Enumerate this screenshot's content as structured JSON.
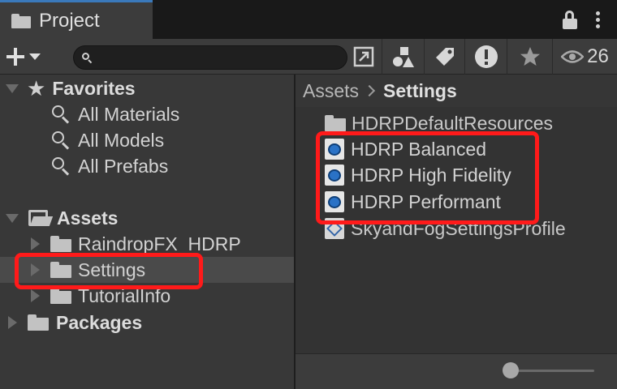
{
  "tab": {
    "title": "Project",
    "icon": "folder-icon"
  },
  "header_icons": [
    "lock-icon",
    "kebab-menu-icon"
  ],
  "toolbar": {
    "search_value": "",
    "buttons": [
      "create-dropdown",
      "search-by-type",
      "search-by-label",
      "search-by-importlog",
      "favorites-star"
    ],
    "visibility_count": "26"
  },
  "favorites": {
    "label": "Favorites",
    "items": [
      {
        "label": "All Materials"
      },
      {
        "label": "All Models"
      },
      {
        "label": "All Prefabs"
      }
    ]
  },
  "assets": {
    "label": "Assets",
    "children": [
      {
        "label": "RaindropFX_HDRP",
        "selected": false
      },
      {
        "label": "Settings",
        "selected": true
      },
      {
        "label": "TutorialInfo",
        "selected": false
      }
    ]
  },
  "packages": {
    "label": "Packages"
  },
  "breadcrumb": {
    "root": "Assets",
    "current": "Settings"
  },
  "right_items": [
    {
      "label": "HDRPDefaultResources",
      "icon": "folder-icon"
    },
    {
      "label": "HDRP Balanced",
      "icon": "render-pipeline-asset-icon"
    },
    {
      "label": "HDRP High Fidelity",
      "icon": "render-pipeline-asset-icon"
    },
    {
      "label": "HDRP Performant",
      "icon": "render-pipeline-asset-icon"
    },
    {
      "label": "SkyandFogSettingsProfile",
      "icon": "volume-profile-icon"
    }
  ],
  "zoom_slider": {
    "value": 0.0
  },
  "colors": {
    "highlight": "#ff1a1a",
    "tab_accent": "#3a79bb",
    "asset_icon_blue": "#2a72c6"
  }
}
